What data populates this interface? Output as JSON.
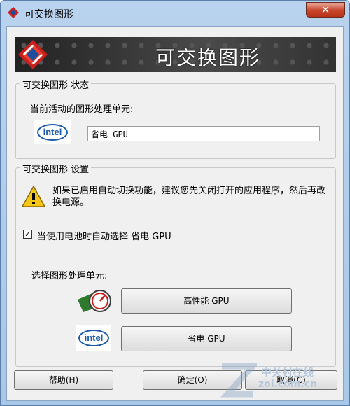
{
  "window": {
    "title": "可交换图形"
  },
  "banner": {
    "title": "可交换图形"
  },
  "status_group": {
    "legend": "可交换图形 状态",
    "current_label": "当前活动的图形处理单元:",
    "current_value": "省电 GPU",
    "logo_text": "intel"
  },
  "settings_group": {
    "legend": "可交换图形 设置",
    "warning_text": "如果已启用自动切换功能，建议您先关闭打开的应用程序，然后再改换电源。",
    "checkbox_label": "当使用电池时自动选择 省电 GPU",
    "checkbox_checked": "✓",
    "select_label": "选择图形处理单元:",
    "high_perf_button": "高性能 GPU",
    "power_save_button": "省电 GPU",
    "intel_logo_text": "intel"
  },
  "footer": {
    "help_button": "帮助(H)",
    "ok_button": "确定(O)",
    "cancel_button": "取消(C)"
  },
  "watermark": {
    "line1": "中关村在线",
    "line2": "zol.com.cn"
  },
  "colors": {
    "accent": "#1a5aa8",
    "close": "#c8462c"
  }
}
